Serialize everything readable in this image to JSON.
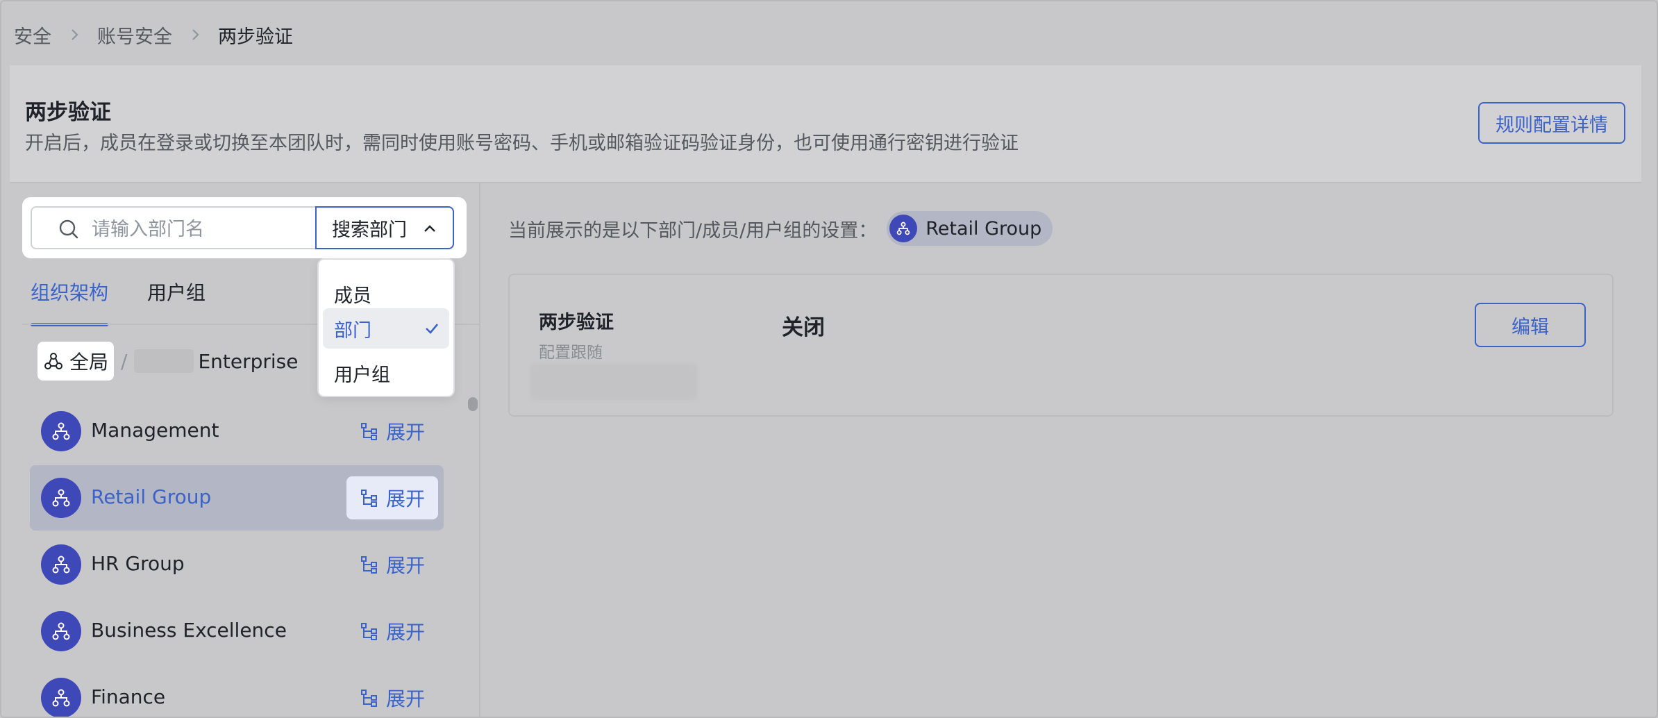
{
  "breadcrumb": {
    "items": [
      "安全",
      "账号安全",
      "两步验证"
    ]
  },
  "header": {
    "title": "两步验证",
    "description": "开启后，成员在登录或切换至本团队时，需同时使用账号密码、手机或邮箱验证码验证身份，也可使用通行密钥进行验证",
    "rules_button": "规则配置详情"
  },
  "search": {
    "placeholder": "请输入部门名",
    "value": "",
    "scope_label": "搜索部门"
  },
  "scope_dropdown": {
    "options": [
      {
        "label": "成员",
        "selected": false
      },
      {
        "label": "部门",
        "selected": true
      },
      {
        "label": "用户组",
        "selected": false
      }
    ]
  },
  "tabs": [
    {
      "label": "组织架构",
      "active": true
    },
    {
      "label": "用户组",
      "active": false
    }
  ],
  "path": {
    "root": "全局",
    "separator": "/",
    "org_suffix": "Enterprise"
  },
  "departments": [
    {
      "name": "Management",
      "expand_label": "展开",
      "selected": false
    },
    {
      "name": "Retail Group",
      "expand_label": "展开",
      "selected": true
    },
    {
      "name": "HR Group",
      "expand_label": "展开",
      "selected": false
    },
    {
      "name": "Business Excellence",
      "expand_label": "展开",
      "selected": false
    },
    {
      "name": "Finance",
      "expand_label": "展开",
      "selected": false
    }
  ],
  "right": {
    "intro": "当前展示的是以下部门/成员/用户组的设置：",
    "current_scope": "Retail Group",
    "setting": {
      "name": "两步验证",
      "sub": "配置跟随",
      "value": "关闭",
      "edit_button": "编辑"
    }
  },
  "colors": {
    "accent": "#3a62c8",
    "avatar": "#3f48b7",
    "selected_row": "#b3b6c4",
    "background": "#c8c8ca"
  },
  "icons": {
    "search": "search-icon",
    "chevron_up": "chevron-up-icon",
    "check": "check-icon",
    "org": "org-chart-icon",
    "tree": "tree-expand-icon",
    "breadcrumb_sep": "chevron-right-icon"
  }
}
